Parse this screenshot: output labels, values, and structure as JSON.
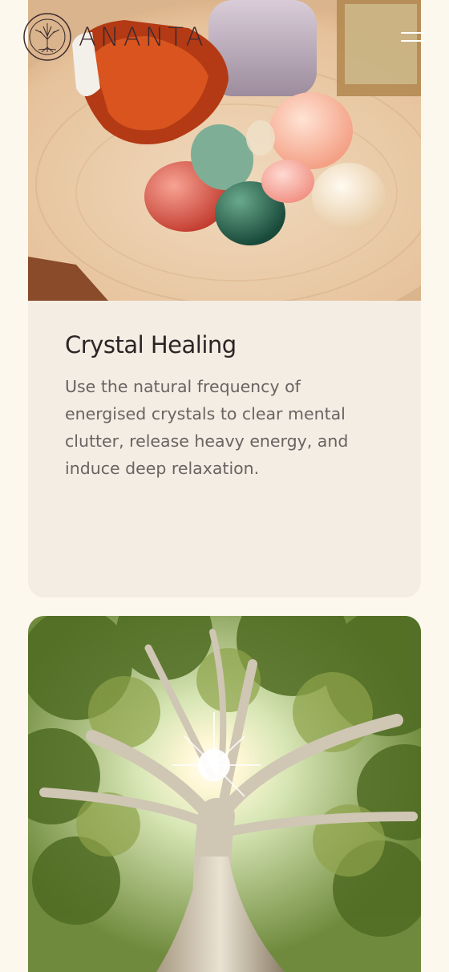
{
  "header": {
    "brand_name": "ANANTA",
    "logo_icon": "tree-of-life-icon",
    "menu_icon": "hamburger-menu-icon"
  },
  "cards": [
    {
      "image_icon": "crystals-photo",
      "title": "Crystal Healing",
      "description": "Use the natural frequency of energised crystals to clear mental clutter, release heavy energy, and induce deep relaxation."
    },
    {
      "image_icon": "sunlit-tree-photo"
    }
  ],
  "colors": {
    "page_background": "#fcf8ee",
    "card_background": "#f3ede3",
    "title": "#2b2426",
    "body_text": "#6b6262",
    "brand": "#3d2a2e"
  }
}
